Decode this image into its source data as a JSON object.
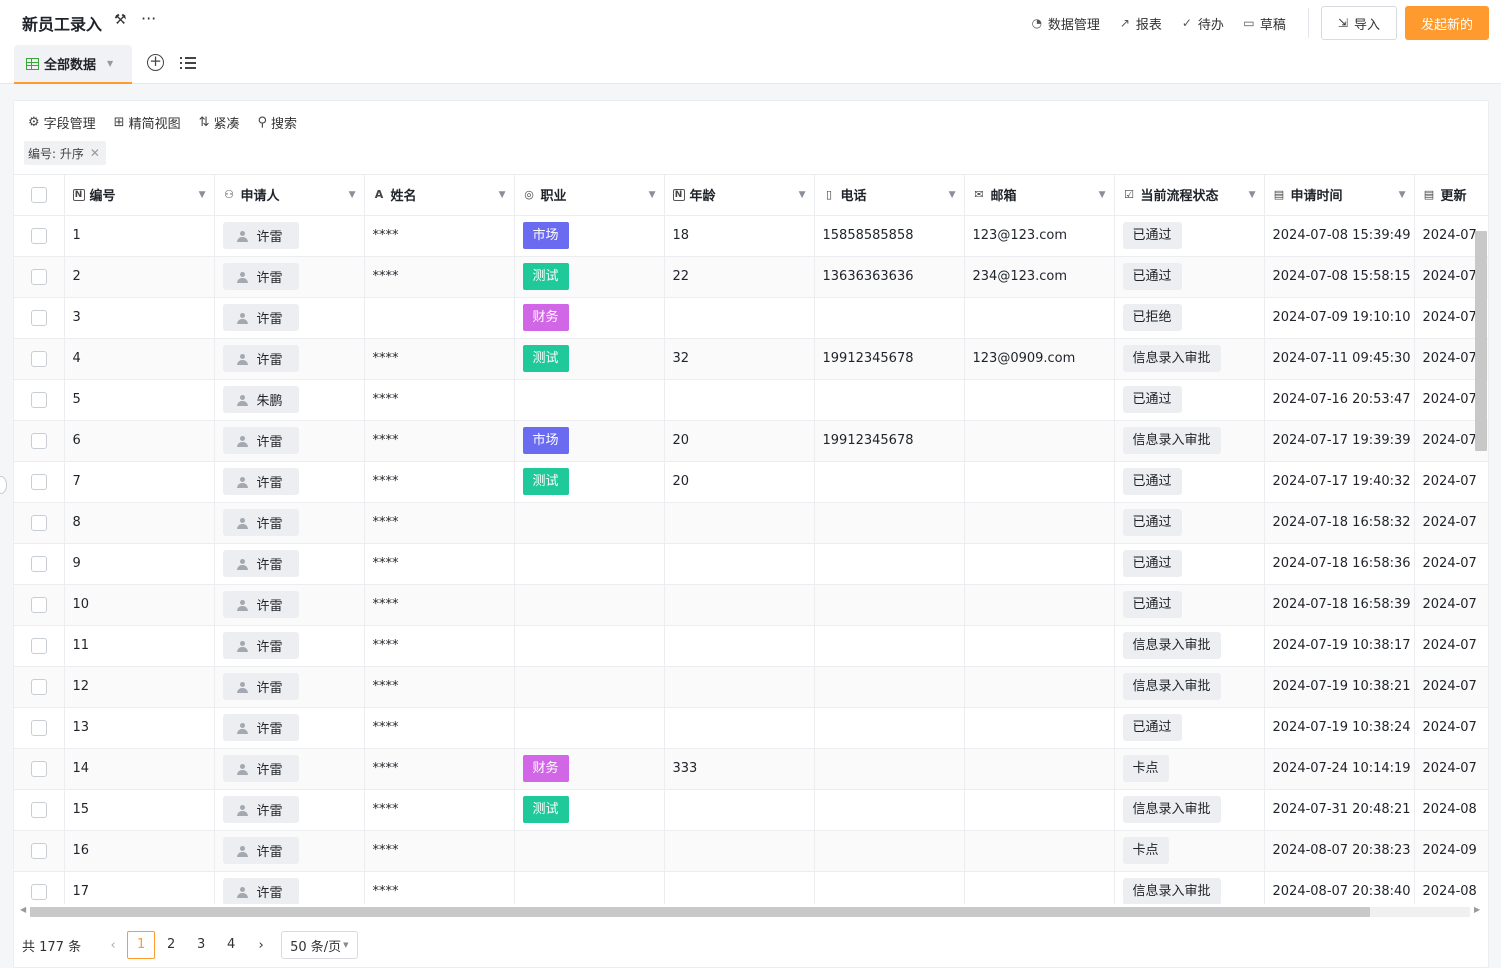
{
  "app": {
    "title": "新员工录入"
  },
  "top_links": [
    {
      "label": "数据管理",
      "icon": "dashboard-icon",
      "glyph": "◔"
    },
    {
      "label": "报表",
      "icon": "trend-chart-icon",
      "glyph": "↗"
    },
    {
      "label": "待办",
      "icon": "check-circle-icon",
      "glyph": "✓"
    },
    {
      "label": "草稿",
      "icon": "inbox-icon",
      "glyph": "▭"
    }
  ],
  "buttons": {
    "import": "导入",
    "start": "发起新的"
  },
  "view_tab": {
    "label": "全部数据"
  },
  "toolbar": {
    "fields": "字段管理",
    "simple_view": "精简视图",
    "compact": "紧凑",
    "search": "搜索"
  },
  "sort_chip": {
    "label": "编号: 升序"
  },
  "columns": [
    {
      "key": "id",
      "label": "编号",
      "icon": "number-field-icon"
    },
    {
      "key": "applicant",
      "label": "申请人",
      "icon": "person-field-icon"
    },
    {
      "key": "name",
      "label": "姓名",
      "icon": "text-field-icon"
    },
    {
      "key": "job",
      "label": "职业",
      "icon": "select-field-icon"
    },
    {
      "key": "age",
      "label": "年龄",
      "icon": "number-field-icon"
    },
    {
      "key": "phone",
      "label": "电话",
      "icon": "phone-field-icon"
    },
    {
      "key": "email",
      "label": "邮箱",
      "icon": "mail-field-icon"
    },
    {
      "key": "status",
      "label": "当前流程状态",
      "icon": "checkbox-field-icon"
    },
    {
      "key": "apply_time",
      "label": "申请时间",
      "icon": "calendar-field-icon"
    },
    {
      "key": "update_time",
      "label": "更新",
      "icon": "calendar-field-icon"
    }
  ],
  "job_colors": {
    "市场": "#6b6bf2",
    "测试": "#1fc99a",
    "财务": "#d166e6"
  },
  "rows": [
    {
      "id": "1",
      "applicant": "许雷",
      "name": "****",
      "job": "市场",
      "age": "18",
      "phone": "15858585858",
      "email": "123@123.com",
      "status": "已通过",
      "apply_time": "2024-07-08 15:39:49",
      "update_time": "2024-07"
    },
    {
      "id": "2",
      "applicant": "许雷",
      "name": "****",
      "job": "测试",
      "age": "22",
      "phone": "13636363636",
      "email": "234@123.com",
      "status": "已通过",
      "apply_time": "2024-07-08 15:58:15",
      "update_time": "2024-07"
    },
    {
      "id": "3",
      "applicant": "许雷",
      "name": "",
      "job": "财务",
      "age": "",
      "phone": "",
      "email": "",
      "status": "已拒绝",
      "apply_time": "2024-07-09 19:10:10",
      "update_time": "2024-07"
    },
    {
      "id": "4",
      "applicant": "许雷",
      "name": "****",
      "job": "测试",
      "age": "32",
      "phone": "19912345678",
      "email": "123@0909.com",
      "status": "信息录入审批",
      "apply_time": "2024-07-11 09:45:30",
      "update_time": "2024-07"
    },
    {
      "id": "5",
      "applicant": "朱鹏",
      "name": "****",
      "job": "",
      "age": "",
      "phone": "",
      "email": "",
      "status": "已通过",
      "apply_time": "2024-07-16 20:53:47",
      "update_time": "2024-07"
    },
    {
      "id": "6",
      "applicant": "许雷",
      "name": "****",
      "job": "市场",
      "age": "20",
      "phone": "19912345678",
      "email": "",
      "status": "信息录入审批",
      "apply_time": "2024-07-17 19:39:39",
      "update_time": "2024-07"
    },
    {
      "id": "7",
      "applicant": "许雷",
      "name": "****",
      "job": "测试",
      "age": "20",
      "phone": "",
      "email": "",
      "status": "已通过",
      "apply_time": "2024-07-17 19:40:32",
      "update_time": "2024-07"
    },
    {
      "id": "8",
      "applicant": "许雷",
      "name": "****",
      "job": "",
      "age": "",
      "phone": "",
      "email": "",
      "status": "已通过",
      "apply_time": "2024-07-18 16:58:32",
      "update_time": "2024-07"
    },
    {
      "id": "9",
      "applicant": "许雷",
      "name": "****",
      "job": "",
      "age": "",
      "phone": "",
      "email": "",
      "status": "已通过",
      "apply_time": "2024-07-18 16:58:36",
      "update_time": "2024-07"
    },
    {
      "id": "10",
      "applicant": "许雷",
      "name": "****",
      "job": "",
      "age": "",
      "phone": "",
      "email": "",
      "status": "已通过",
      "apply_time": "2024-07-18 16:58:39",
      "update_time": "2024-07"
    },
    {
      "id": "11",
      "applicant": "许雷",
      "name": "****",
      "job": "",
      "age": "",
      "phone": "",
      "email": "",
      "status": "信息录入审批",
      "apply_time": "2024-07-19 10:38:17",
      "update_time": "2024-07"
    },
    {
      "id": "12",
      "applicant": "许雷",
      "name": "****",
      "job": "",
      "age": "",
      "phone": "",
      "email": "",
      "status": "信息录入审批",
      "apply_time": "2024-07-19 10:38:21",
      "update_time": "2024-07"
    },
    {
      "id": "13",
      "applicant": "许雷",
      "name": "****",
      "job": "",
      "age": "",
      "phone": "",
      "email": "",
      "status": "已通过",
      "apply_time": "2024-07-19 10:38:24",
      "update_time": "2024-07"
    },
    {
      "id": "14",
      "applicant": "许雷",
      "name": "****",
      "job": "财务",
      "age": "333",
      "phone": "",
      "email": "",
      "status": "卡点",
      "apply_time": "2024-07-24 10:14:19",
      "update_time": "2024-07"
    },
    {
      "id": "15",
      "applicant": "许雷",
      "name": "****",
      "job": "测试",
      "age": "",
      "phone": "",
      "email": "",
      "status": "信息录入审批",
      "apply_time": "2024-07-31 20:48:21",
      "update_time": "2024-08"
    },
    {
      "id": "16",
      "applicant": "许雷",
      "name": "****",
      "job": "",
      "age": "",
      "phone": "",
      "email": "",
      "status": "卡点",
      "apply_time": "2024-08-07 20:38:23",
      "update_time": "2024-09"
    },
    {
      "id": "17",
      "applicant": "许雷",
      "name": "****",
      "job": "",
      "age": "",
      "phone": "",
      "email": "",
      "status": "信息录入审批",
      "apply_time": "2024-08-07 20:38:40",
      "update_time": "2024-08"
    }
  ],
  "pagination": {
    "total": "共 177 条",
    "pages": [
      "1",
      "2",
      "3",
      "4"
    ],
    "current": "1",
    "page_size": "50 条/页"
  }
}
